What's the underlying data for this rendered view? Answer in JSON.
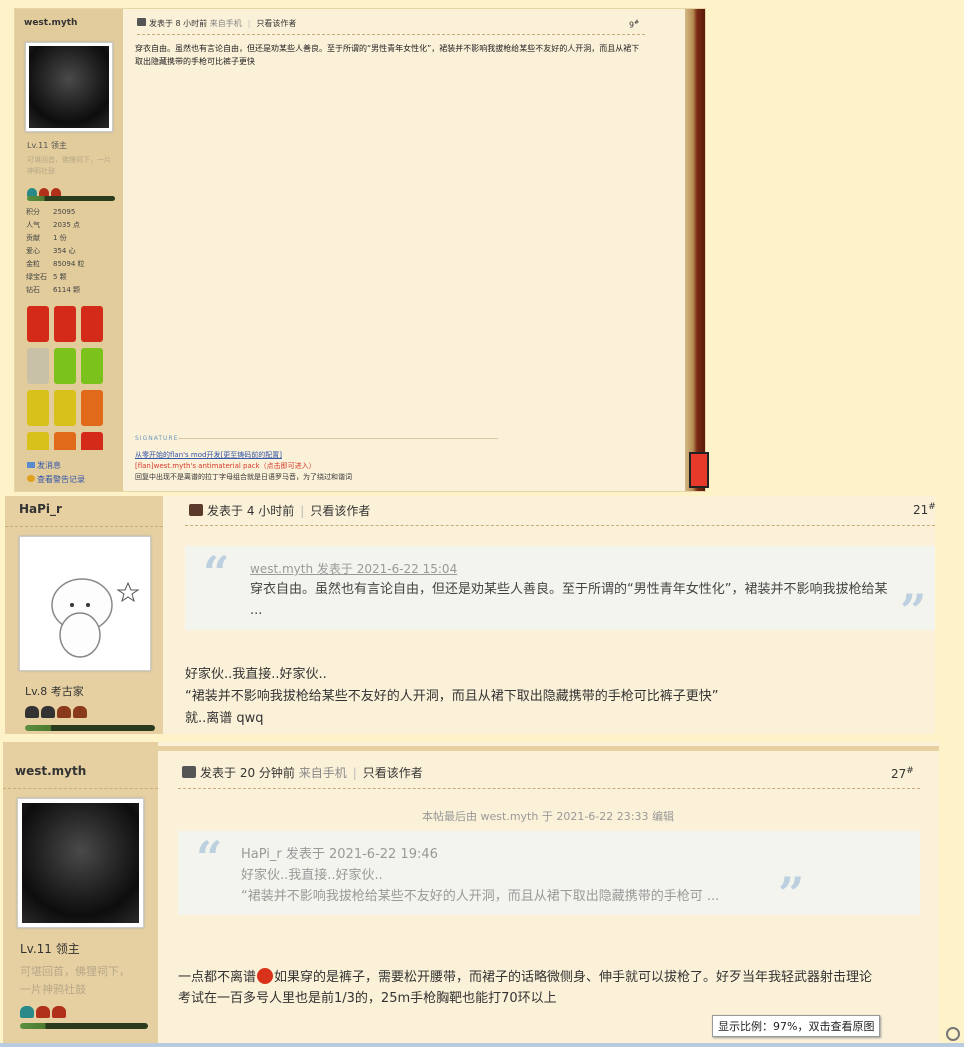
{
  "post1": {
    "author": "west.myth",
    "meta_time": "发表于 8 小时前",
    "meta_source": "来自手机",
    "meta_only_author": "只看该作者",
    "floor": "9",
    "floor_sup": "#",
    "body": "穿衣自由。虽然也有言论自由，但还是劝某些人善良。至于所谓的“男性青年女性化”，裙装并不影响我拔枪给某些不友好的人开洞，而且从裙下取出隐藏携带的手枪可比裤子更快",
    "level": "Lv.11 领主",
    "user_title": "可堪回首，佛狸祠下，一片神鸦社鼓",
    "stats": [
      {
        "k": "积分",
        "v": "25095"
      },
      {
        "k": "人气",
        "v": "2035 点"
      },
      {
        "k": "贡献",
        "v": "1 份"
      },
      {
        "k": "爱心",
        "v": "354 心"
      },
      {
        "k": "金粒",
        "v": "85094 粒"
      },
      {
        "k": "绿宝石",
        "v": "5 颗"
      },
      {
        "k": "钻石",
        "v": "6114 颗"
      }
    ],
    "signature_label": "SIGNATURE",
    "sig_line1": "从零开始的flan's mod开发[更至铸码前的配置]",
    "sig_line2": "[flan]west.myth's antimaterial pack（点击即可进入）",
    "sig_line3": "回复中出现不是离谱的拉丁字母组合就是日语罗马音，为了绕过和谐词",
    "send_msg": "发消息",
    "warn_log": "查看警告记录"
  },
  "post2": {
    "author": "HaPi_r",
    "meta_time": "发表于 4 小时前",
    "meta_only_author": "只看该作者",
    "floor": "21",
    "floor_sup": "#",
    "quote_head": "west.myth 发表于 2021-6-22 15:04",
    "quote_text": "穿衣自由。虽然也有言论自由，但还是劝某些人善良。至于所谓的“男性青年女性化”，裙装并不影响我拔枪给某 ...",
    "line1": "好家伙..我直接..好家伙..",
    "line2": "“裙装并不影响我拔枪给某些不友好的人开洞，而且从裙下取出隐藏携带的手枪可比裤子更快”",
    "line3": "就..离谱 qwq",
    "level": "Lv.8 考古家"
  },
  "post3": {
    "author": "west.myth",
    "meta_time": "发表于 20 分钟前",
    "meta_source": "来自手机",
    "meta_only_author": "只看该作者",
    "floor": "27",
    "floor_sup": "#",
    "edit_note": "本帖最后由 west.myth 于 2021-6-22 23:33 编辑",
    "quote_head": "HaPi_r 发表于 2021-6-22 19:46",
    "quote_l1": "好家伙..我直接..好家伙..",
    "quote_l2": "“裙装并不影响我拔枪给某些不友好的人开洞，而且从裙下取出隐藏携带的手枪可 ...",
    "body_a": "一点都不离谱",
    "body_b": "如果穿的是裤子，需要松开腰带，而裙子的话略微侧身、伸手就可以拔枪了。好歹当年我轻武器射击理论",
    "body_c": "考试在一百多号人里也是前1/3的，25m手枪胸靶也能打70环以上",
    "level": "Lv.11 领主",
    "user_title_1": "可堪回首，佛狸祠下，",
    "user_title_2": "一片神鸦社鼓"
  },
  "zoom_hint": "显示比例：97%，双击查看原图",
  "colors": {
    "accent_red": "#d43a2a",
    "link_blue": "#3355aa",
    "quote_mark": "#bcd0e0"
  }
}
